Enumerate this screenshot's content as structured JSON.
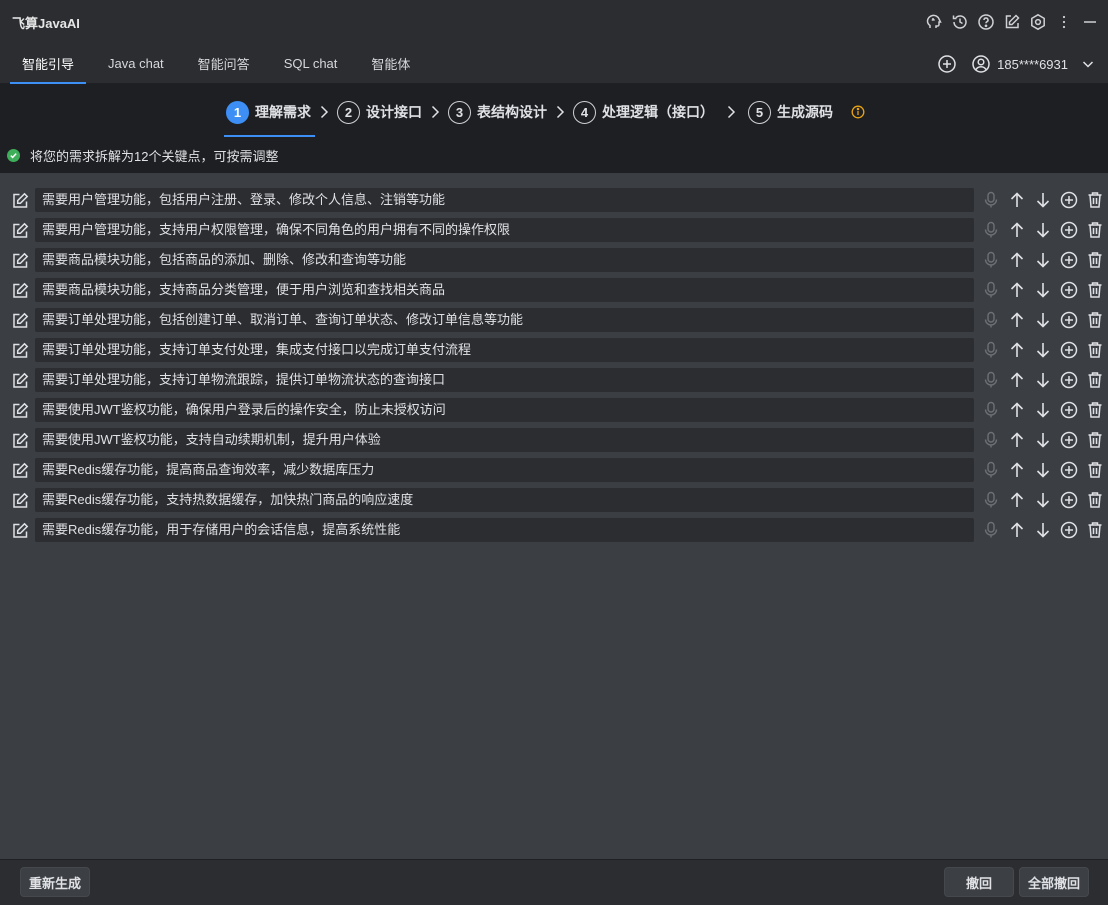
{
  "app": {
    "title": "飞算JavaAI"
  },
  "tabs": [
    {
      "label": "智能引导",
      "active": true
    },
    {
      "label": "Java chat",
      "active": false
    },
    {
      "label": "智能问答",
      "active": false
    },
    {
      "label": "SQL chat",
      "active": false
    },
    {
      "label": "智能体",
      "active": false
    }
  ],
  "user": {
    "name": "185****6931"
  },
  "steps": [
    {
      "num": "1",
      "label": "理解需求",
      "active": true
    },
    {
      "num": "2",
      "label": "设计接口",
      "active": false
    },
    {
      "num": "3",
      "label": "表结构设计",
      "active": false
    },
    {
      "num": "4",
      "label": "处理逻辑（接口）",
      "active": false
    },
    {
      "num": "5",
      "label": "生成源码",
      "active": false
    }
  ],
  "hint": "将您的需求拆解为12个关键点，可按需调整",
  "requirements": [
    "需要用户管理功能，包括用户注册、登录、修改个人信息、注销等功能",
    "需要用户管理功能，支持用户权限管理，确保不同角色的用户拥有不同的操作权限",
    "需要商品模块功能，包括商品的添加、删除、修改和查询等功能",
    "需要商品模块功能，支持商品分类管理，便于用户浏览和查找相关商品",
    "需要订单处理功能，包括创建订单、取消订单、查询订单状态、修改订单信息等功能",
    "需要订单处理功能，支持订单支付处理，集成支付接口以完成订单支付流程",
    "需要订单处理功能，支持订单物流跟踪，提供订单物流状态的查询接口",
    "需要使用JWT鉴权功能，确保用户登录后的操作安全，防止未授权访问",
    "需要使用JWT鉴权功能，支持自动续期机制，提升用户体验",
    "需要Redis缓存功能，提高商品查询效率，减少数据库压力",
    "需要Redis缓存功能，支持热数据缓存，加快热门商品的响应速度",
    "需要Redis缓存功能，用于存储用户的会话信息，提高系统性能"
  ],
  "footer": {
    "regenerate": "重新生成",
    "undo": "撤回",
    "undo_all": "全部撤回"
  },
  "colors": {
    "accent": "#3d8ff5",
    "success": "#3fae5a",
    "warning": "#e8a317"
  }
}
